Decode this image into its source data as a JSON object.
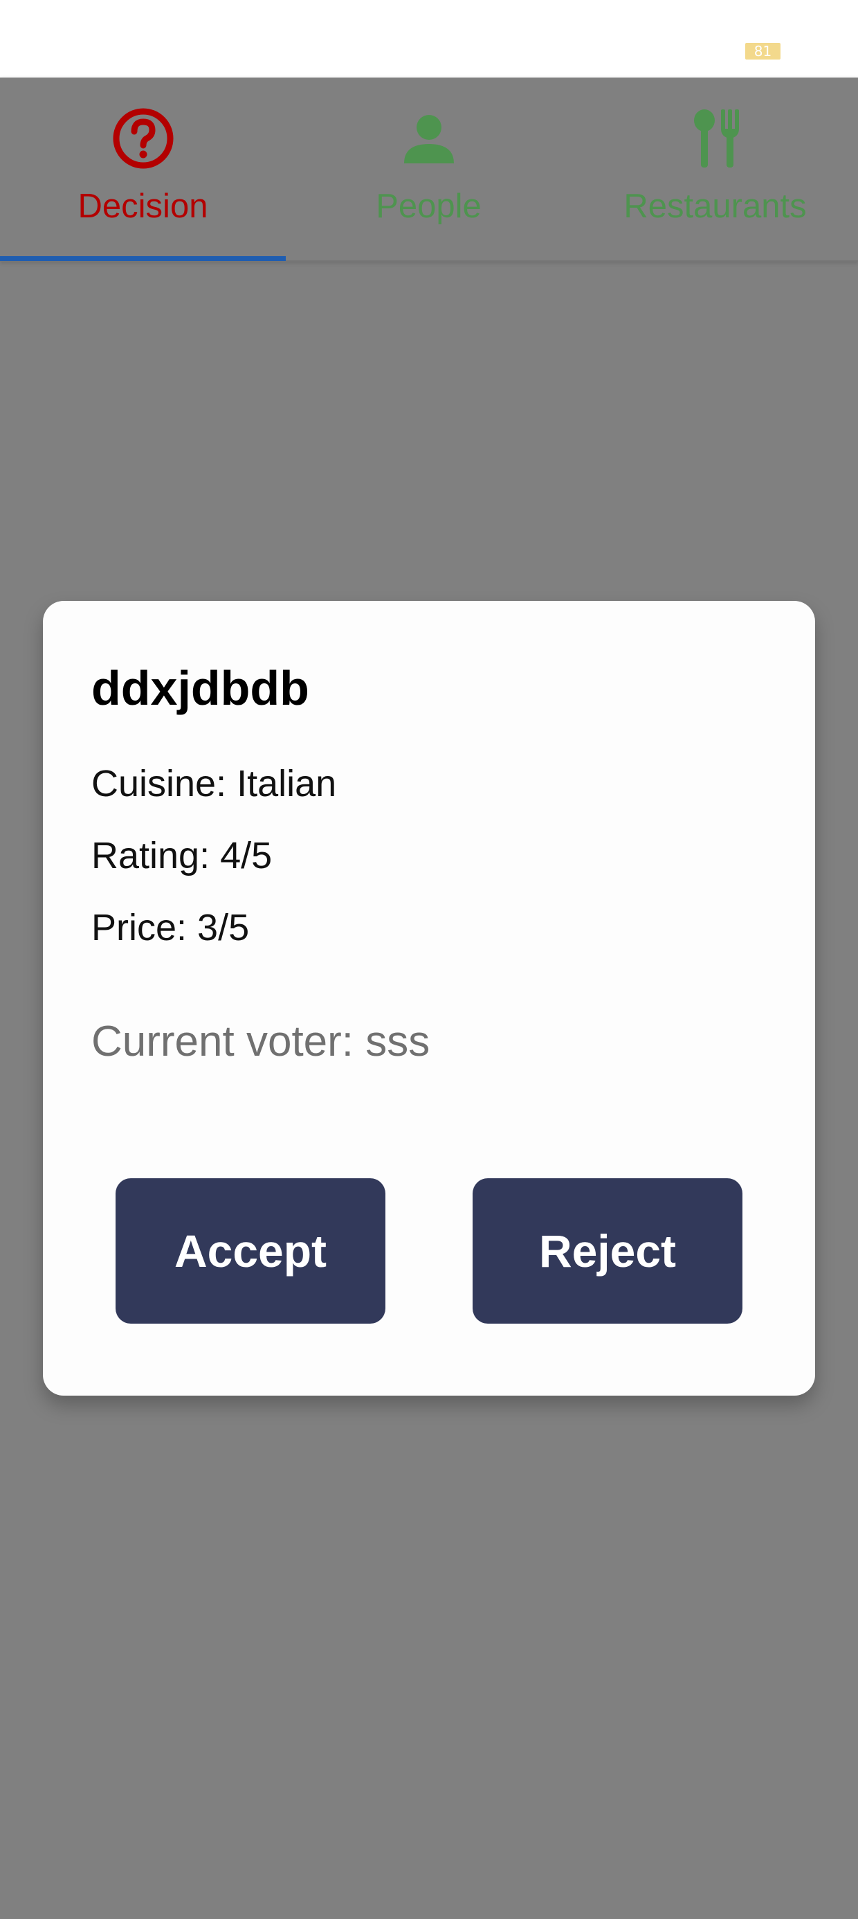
{
  "status_bar": {
    "battery_level": "81"
  },
  "tabs": [
    {
      "label": "Decision",
      "icon": "question-circle-icon",
      "selected": true,
      "color": "#b30000"
    },
    {
      "label": "People",
      "icon": "person-icon",
      "selected": false,
      "color": "#4e944f"
    },
    {
      "label": "Restaurants",
      "icon": "fork-knife-icon",
      "selected": false,
      "color": "#4e944f"
    }
  ],
  "dialog": {
    "title": "ddxjdbdb",
    "cuisine": "Cuisine: Italian",
    "rating": "Rating: 4/5",
    "price": "Price: 3/5",
    "current_voter": "Current voter: sss",
    "accept_label": "Accept",
    "reject_label": "Reject"
  },
  "colors": {
    "scrim": "#808080",
    "button": "#32395a",
    "tab_indicator": "#1f5db0"
  }
}
